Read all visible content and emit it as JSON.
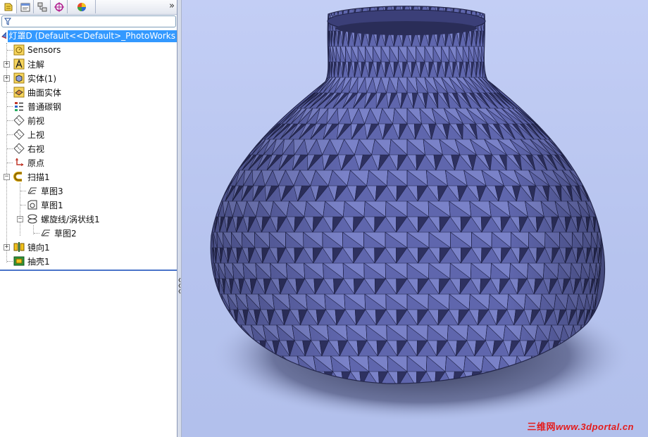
{
  "feature_manager": {
    "tabs": [
      {
        "name": "feature-manager-tab",
        "icon": "feature-tree-icon"
      },
      {
        "name": "property-manager-tab",
        "icon": "property-manager-icon"
      },
      {
        "name": "configuration-manager-tab",
        "icon": "configuration-manager-icon"
      },
      {
        "name": "dimxpert-tab",
        "icon": "dimxpert-icon"
      },
      {
        "name": "display-manager-tab",
        "icon": "display-manager-icon"
      }
    ],
    "more_tabs": "»",
    "filter_icon": "filter-icon",
    "root": "灯罩D  (Default<<Default>_PhotoWorks",
    "items": [
      {
        "label": "Sensors",
        "icon": "sensors-icon"
      },
      {
        "label": "注解",
        "icon": "annotations-icon"
      },
      {
        "label": "实体(1)",
        "icon": "solid-bodies-icon"
      },
      {
        "label": "曲面实体",
        "icon": "surface-bodies-icon"
      },
      {
        "label": "普通碳钢",
        "icon": "material-icon"
      },
      {
        "label": "前视",
        "icon": "plane-icon"
      },
      {
        "label": "上视",
        "icon": "plane-icon"
      },
      {
        "label": "右视",
        "icon": "plane-icon"
      },
      {
        "label": "原点",
        "icon": "origin-icon"
      },
      {
        "label": "扫描1",
        "icon": "sweep-icon"
      },
      {
        "label": "草图3",
        "icon": "sketch-icon"
      },
      {
        "label": "草图1",
        "icon": "sketch-icon"
      },
      {
        "label": "螺旋线/涡状线1",
        "icon": "helix-icon"
      },
      {
        "label": "草图2",
        "icon": "sketch-icon"
      },
      {
        "label": "镜向1",
        "icon": "mirror-icon"
      },
      {
        "label": "抽壳1",
        "icon": "shell-icon"
      }
    ]
  },
  "viewport": {
    "model": "faceted-vase-lampshade",
    "colors": {
      "model_face_light": "#7a82c8",
      "model_face_dark": "#2e3160",
      "background": "#b9c6ee"
    }
  },
  "watermark": {
    "cn": "三维网",
    "url": "www.3dportal.cn"
  }
}
